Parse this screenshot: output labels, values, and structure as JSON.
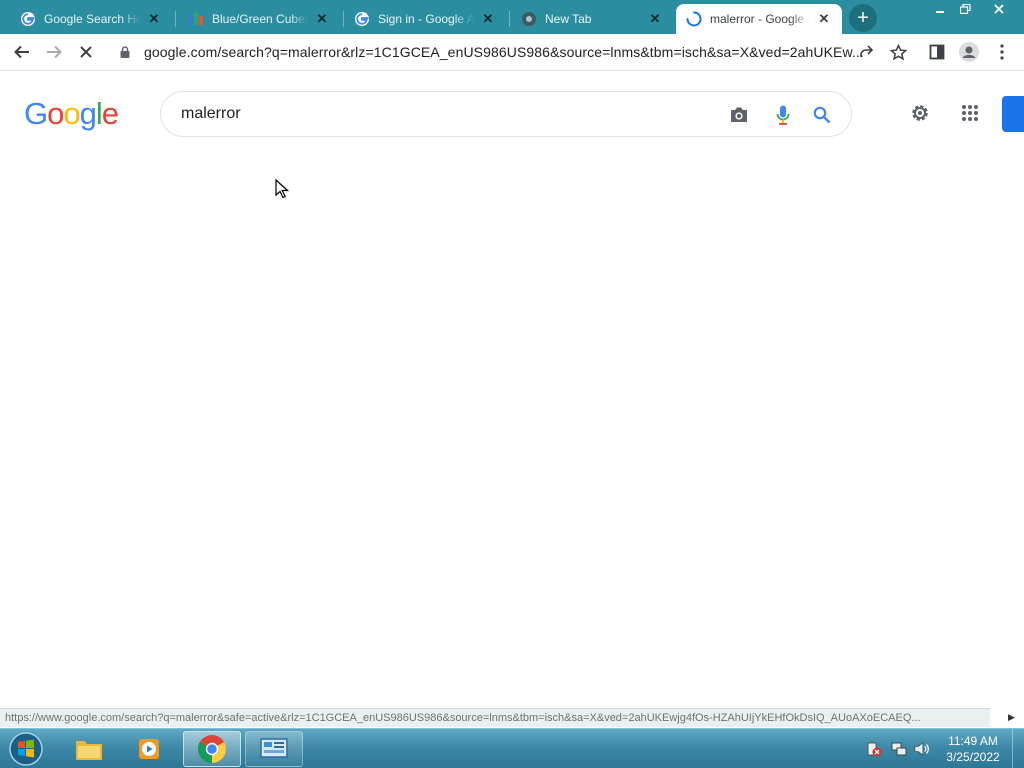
{
  "browser": {
    "tabs": [
      {
        "title": "Google Search Help",
        "icon": "google-g-icon"
      },
      {
        "title": "Blue/Green Cubes",
        "icon": "cubes-icon"
      },
      {
        "title": "Sign in - Google Accounts",
        "icon": "google-g-icon"
      },
      {
        "title": "New Tab",
        "icon": "chrome-icon"
      },
      {
        "title": "malerror - Google Search",
        "icon": "loading-spinner-icon",
        "active": true
      }
    ],
    "new_tab_label": "+",
    "url": "google.com/search?q=malerror&rlz=1C1GCEA_enUS986US986&source=lnms&tbm=isch&sa=X&ved=2ahUKEw..."
  },
  "google": {
    "logo_letters": [
      "G",
      "o",
      "o",
      "g",
      "l",
      "e"
    ],
    "logo_colors": [
      "#4285f4",
      "#ea4335",
      "#fbbc05",
      "#4285f4",
      "#34a853",
      "#ea4335"
    ],
    "search_query": "malerror"
  },
  "status_url": "https://www.google.com/search?q=malerror&safe=active&rlz=1C1GCEA_enUS986US986&source=lnms&tbm=isch&sa=X&ved=2ahUKEwjg4fOs-HZAhUIjYkEHfOkDsIQ_AUoAXoECAEQ...",
  "taskbar": {
    "time": "11:49 AM",
    "date": "3/25/2022"
  },
  "colors": {
    "tabstrip": "#2a8ea0",
    "accent_blue": "#1a73e8"
  }
}
